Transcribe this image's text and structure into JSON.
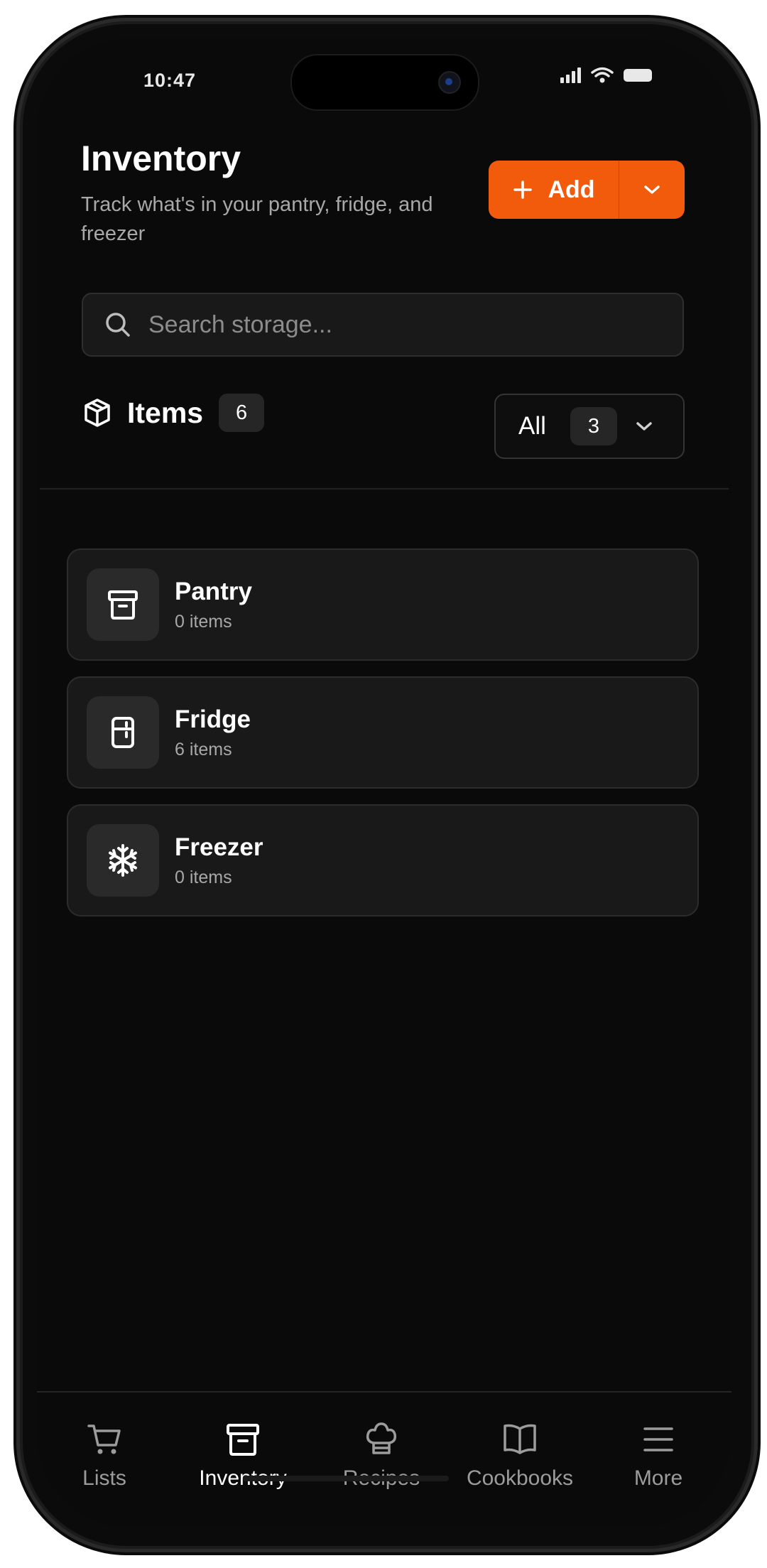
{
  "status_bar": {
    "time": "10:47"
  },
  "header": {
    "title": "Inventory",
    "subtitle": "Track what's in your pantry, fridge, and freezer",
    "add_label": "Add"
  },
  "search": {
    "placeholder": "Search storage..."
  },
  "items_section": {
    "label": "Items",
    "count": "6"
  },
  "filter": {
    "selected": "All",
    "count": "3"
  },
  "storage_locations": [
    {
      "name": "Pantry",
      "count": "0 items",
      "icon": "archive-box-icon"
    },
    {
      "name": "Fridge",
      "count": "6 items",
      "icon": "fridge-icon"
    },
    {
      "name": "Freezer",
      "count": "0 items",
      "icon": "snowflake-icon"
    }
  ],
  "tabs": [
    {
      "label": "Lists",
      "icon": "cart-icon",
      "active": false
    },
    {
      "label": "Inventory",
      "icon": "archive-box-icon",
      "active": true
    },
    {
      "label": "Recipes",
      "icon": "chef-hat-icon",
      "active": false
    },
    {
      "label": "Cookbooks",
      "icon": "book-open-icon",
      "active": false
    },
    {
      "label": "More",
      "icon": "menu-icon",
      "active": false
    }
  ],
  "colors": {
    "accent": "#f25a0c",
    "background": "#0a0a0a",
    "card": "#191919"
  }
}
